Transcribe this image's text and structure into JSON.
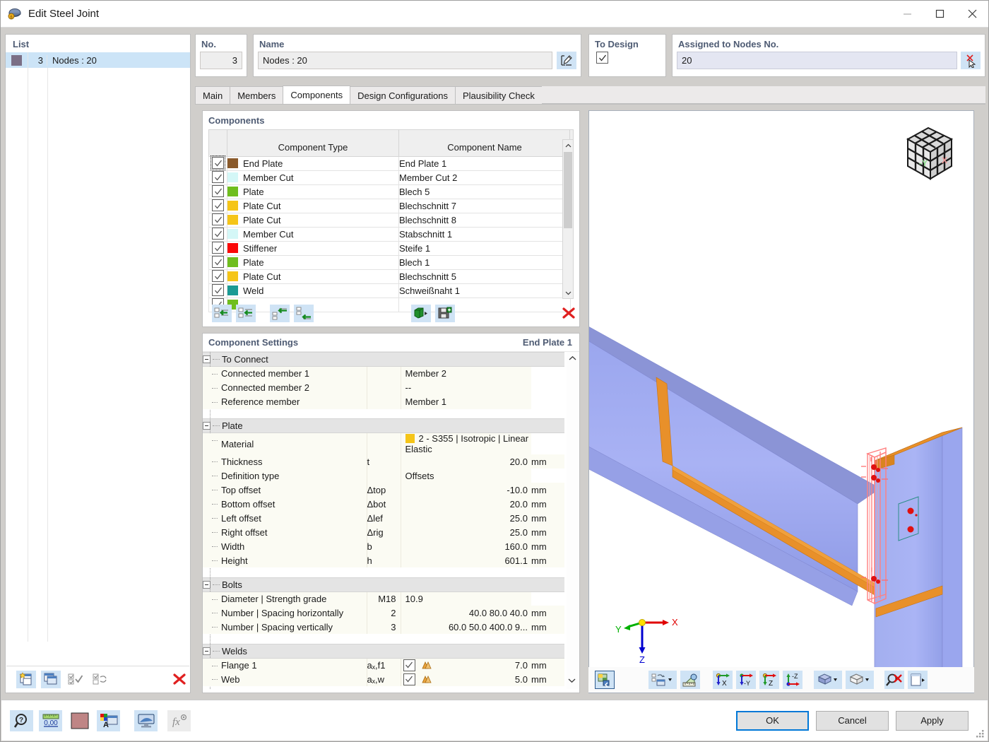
{
  "window": {
    "title": "Edit Steel Joint",
    "icon": "steel-joint-icon",
    "minimize": "—",
    "maximize": "□",
    "close": "✕"
  },
  "list": {
    "caption": "List",
    "rows": [
      {
        "no": "3",
        "name": "Nodes : 20",
        "color": "#7b6f86"
      }
    ],
    "toolbar": [
      {
        "name": "new-joint-button",
        "icon": "new-window-icon"
      },
      {
        "name": "copy-joint-button",
        "icon": "copy-window-icon"
      },
      {
        "name": "select-all-button",
        "icon": "check-all-icon"
      },
      {
        "name": "invert-selection-button",
        "icon": "invert-check-icon"
      },
      {
        "name": "delete-joint-button",
        "icon": "red-x-icon"
      }
    ]
  },
  "header": {
    "no_label": "No.",
    "no_value": "3",
    "name_label": "Name",
    "name_value": "Nodes : 20",
    "name_edit_icon": "edit-pencil-icon",
    "to_design_label": "To Design",
    "to_design_checked": true,
    "assigned_label": "Assigned to Nodes No.",
    "assigned_value": "20",
    "assigned_pick_icon": "pick-cursor-icon"
  },
  "tabs": [
    {
      "label": "Main",
      "active": false
    },
    {
      "label": "Members",
      "active": false
    },
    {
      "label": "Components",
      "active": true
    },
    {
      "label": "Design Configurations",
      "active": false
    },
    {
      "label": "Plausibility Check",
      "active": false
    }
  ],
  "components": {
    "caption": "Components",
    "columns": [
      "Component Type",
      "Component Name"
    ],
    "rows": [
      {
        "checked": true,
        "color": "#8a5a2b",
        "type": "End Plate",
        "name": "End Plate 1"
      },
      {
        "checked": true,
        "color": "#d4f7f7",
        "type": "Member Cut",
        "name": "Member Cut 2"
      },
      {
        "checked": true,
        "color": "#6fbe1e",
        "type": "Plate",
        "name": "Blech 5"
      },
      {
        "checked": true,
        "color": "#f5c518",
        "type": "Plate Cut",
        "name": "Blechschnitt 7"
      },
      {
        "checked": true,
        "color": "#f5c518",
        "type": "Plate Cut",
        "name": "Blechschnitt 8"
      },
      {
        "checked": true,
        "color": "#d4f7f7",
        "type": "Member Cut",
        "name": "Stabschnitt 1"
      },
      {
        "checked": true,
        "color": "#fb0707",
        "type": "Stiffener",
        "name": "Steife 1"
      },
      {
        "checked": true,
        "color": "#6fbe1e",
        "type": "Plate",
        "name": "Blech 1"
      },
      {
        "checked": true,
        "color": "#f5c518",
        "type": "Plate Cut",
        "name": "Blechschnitt 5"
      },
      {
        "checked": true,
        "color": "#1a9a94",
        "type": "Weld",
        "name": "Schweißnaht 1"
      }
    ],
    "toolbar": [
      {
        "name": "insert-component-button",
        "icon": "insert-left-arrow-icon"
      },
      {
        "name": "insert-component-above-button",
        "icon": "insert-above-arrow-icon"
      },
      {
        "name": "move-component-up-button",
        "icon": "move-up-arrow-icon"
      },
      {
        "name": "move-component-down-button",
        "icon": "move-down-arrow-icon"
      },
      {
        "name": "import-component-button",
        "icon": "import-green-icon"
      },
      {
        "name": "save-component-button",
        "icon": "save-floppy-icon"
      },
      {
        "name": "delete-component-button",
        "icon": "red-x-icon"
      }
    ]
  },
  "settings": {
    "caption": "Component Settings",
    "selected_component": "End Plate 1",
    "groups": [
      {
        "title": "To Connect",
        "rows": [
          {
            "label": "Connected member 1",
            "sym": "",
            "value": "Member 2",
            "align": "left",
            "unit": ""
          },
          {
            "label": "Connected member 2",
            "sym": "",
            "value": "--",
            "align": "left",
            "unit": ""
          },
          {
            "label": "Reference member",
            "sym": "",
            "value": "Member 1",
            "align": "left",
            "unit": ""
          }
        ]
      },
      {
        "title": "Plate",
        "rows": [
          {
            "label": "Material",
            "sym": "",
            "value": "2 - S355 | Isotropic | Linear Elastic",
            "align": "left",
            "unit": "",
            "swatch": "#f5c518"
          },
          {
            "label": "Thickness",
            "sym": "t",
            "value": "20.0",
            "align": "right",
            "unit": "mm"
          },
          {
            "label": "Definition type",
            "sym": "",
            "value": "Offsets",
            "align": "left",
            "unit": ""
          },
          {
            "label": "Top offset",
            "sym": "Δtop",
            "value": "-10.0",
            "align": "right",
            "unit": "mm"
          },
          {
            "label": "Bottom offset",
            "sym": "Δbot",
            "value": "20.0",
            "align": "right",
            "unit": "mm"
          },
          {
            "label": "Left offset",
            "sym": "Δlef",
            "value": "25.0",
            "align": "right",
            "unit": "mm"
          },
          {
            "label": "Right offset",
            "sym": "Δrig",
            "value": "25.0",
            "align": "right",
            "unit": "mm"
          },
          {
            "label": "Width",
            "sym": "b",
            "value": "160.0",
            "align": "right",
            "unit": "mm"
          },
          {
            "label": "Height",
            "sym": "h",
            "value": "601.1",
            "align": "right",
            "unit": "mm"
          }
        ]
      },
      {
        "title": "Bolts",
        "rows": [
          {
            "label": "Diameter | Strength grade",
            "sym": "",
            "mid": "M18",
            "value": "10.9",
            "align": "left",
            "unit": ""
          },
          {
            "label": "Number | Spacing horizontally",
            "sym": "",
            "mid": "2",
            "value": "40.0 80.0 40.0",
            "align": "right",
            "unit": "mm"
          },
          {
            "label": "Number | Spacing vertically",
            "sym": "",
            "mid": "3",
            "value": "60.0 50.0 400.0 9...",
            "align": "right",
            "unit": "mm"
          }
        ]
      },
      {
        "title": "Welds",
        "rows": [
          {
            "label": "Flange 1",
            "sym": "aₓ,f1",
            "checkbox": true,
            "weldicon": "fillet-weld-icon",
            "value": "7.0",
            "align": "right",
            "unit": "mm"
          },
          {
            "label": "Web",
            "sym": "aₓ,w",
            "checkbox": true,
            "weldicon": "fillet-weld-icon",
            "value": "5.0",
            "align": "right",
            "unit": "mm"
          }
        ]
      }
    ]
  },
  "viewport": {
    "nav_cube": {
      "face_left": "-Y",
      "face_right": "X"
    },
    "axes": {
      "x": "X",
      "y": "Y",
      "z": "Z",
      "x_color": "#e00000",
      "y_color": "#00b000",
      "z_color": "#0000d0"
    },
    "toolbar": [
      {
        "name": "render-mode-button",
        "icon": "render-view-icon",
        "selected": true
      },
      {
        "name": "display-properties-button",
        "icon": "display-props-icon",
        "dropdown": true
      },
      {
        "name": "measure-button",
        "icon": "ruler-measure-icon"
      },
      {
        "name": "view-in-x-button",
        "icon": "view-x-icon"
      },
      {
        "name": "view-in-y-button",
        "icon": "view-minus-y-icon"
      },
      {
        "name": "view-in-z-button",
        "icon": "view-z-icon"
      },
      {
        "name": "view-in-minus-z-button",
        "icon": "view-minus-z-icon"
      },
      {
        "name": "solid-model-button",
        "icon": "solid-model-icon",
        "dropdown": true
      },
      {
        "name": "wireframe-button",
        "icon": "wireframe-cube-icon",
        "dropdown": true
      },
      {
        "name": "zoom-reset-button",
        "icon": "zoom-cancel-icon"
      },
      {
        "name": "panel-toggle-button",
        "icon": "panel-toggle-icon"
      }
    ]
  },
  "bottom": {
    "tools": [
      {
        "name": "help-button",
        "icon": "help-magnifier-icon",
        "enabled": true
      },
      {
        "name": "units-button",
        "icon": "units-000-icon",
        "enabled": true
      },
      {
        "name": "color-button",
        "icon": "color-swatch-icon",
        "enabled": true
      },
      {
        "name": "text-colors-button",
        "icon": "text-colors-icon",
        "enabled": true
      },
      {
        "name": "display-button",
        "icon": "monitor-icon",
        "enabled": true
      },
      {
        "name": "formula-button",
        "icon": "fx-icon",
        "enabled": false
      }
    ],
    "ok": "OK",
    "cancel": "Cancel",
    "apply": "Apply"
  }
}
